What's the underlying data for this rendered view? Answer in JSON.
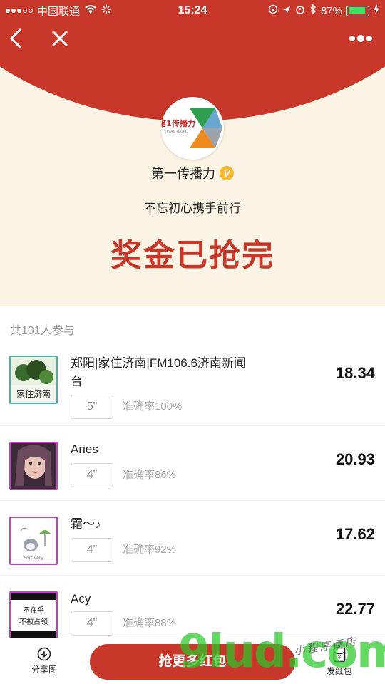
{
  "status_bar": {
    "carrier": "中国联通",
    "time": "15:24",
    "battery": "87%",
    "battery_level": 0.87
  },
  "nav": {
    "back_icon": "chevron-left-icon",
    "close_icon": "close-icon",
    "more_icon": "more-dots-icon"
  },
  "publisher": {
    "logo_text": "第1传播力",
    "logo_sub": "JINAN RADIO",
    "name": "第一传播力",
    "verified_badge": "V",
    "slogan": "不忘初心携手前行"
  },
  "headline": "奖金已抢完",
  "participants_label": "共101人参与",
  "entries": [
    {
      "name": "郑阳|家住济南|FM106.6济南新闻台",
      "time": "5\"",
      "accuracy": "准确率100%",
      "amount": "18.34",
      "avatar_text": "家住济南",
      "avatar_border": "#46b4a8"
    },
    {
      "name": "Aries",
      "time": "4\"",
      "accuracy": "准确率86%",
      "amount": "20.93",
      "avatar_border": "#c43ec8"
    },
    {
      "name": "霜～♪",
      "time": "4\"",
      "accuracy": "准确率92%",
      "amount": "17.62",
      "avatar_border": "#c43ec8"
    },
    {
      "name": "Acy",
      "time": "4\"",
      "accuracy": "准确率88%",
      "amount": "22.77",
      "avatar_text": "不在乎 不被占领",
      "avatar_border": "#c43ec8"
    }
  ],
  "bottom": {
    "share_label": "分享图",
    "grab_label": "抢更多红包",
    "send_label": "发红包"
  },
  "watermark": {
    "main": "9lud.com",
    "sub": "小程序商店"
  },
  "colors": {
    "brand_red": "#c7372a",
    "cream": "#fbf3e3",
    "gold": "#f5b82e"
  }
}
